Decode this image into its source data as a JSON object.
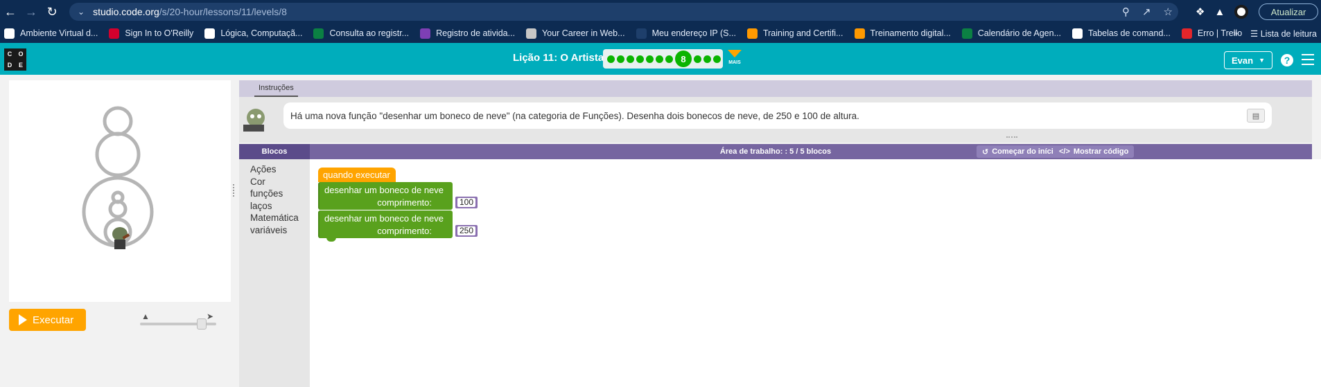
{
  "browser": {
    "url_host": "studio.code.org",
    "url_path": "/s/20-hour/lessons/11/levels/8",
    "update_label": "Atualizar"
  },
  "bookmarks": [
    {
      "label": "Ambiente Virtual d...",
      "icon": "globe-icon",
      "color": "#ffffff"
    },
    {
      "label": "Sign In to O'Reilly",
      "icon": "oreilly-icon",
      "color": "#d3002d"
    },
    {
      "label": "Lógica, Computaçã...",
      "icon": "notion-icon",
      "color": "#ffffff"
    },
    {
      "label": "Consulta ao registr...",
      "icon": "plus-icon",
      "color": "#0b8043"
    },
    {
      "label": "Registro de atividа...",
      "icon": "list-icon",
      "color": "#7e3fb5"
    },
    {
      "label": "Your Career in Web...",
      "icon": "career-icon",
      "color": "#c7c7c7"
    },
    {
      "label": "Meu endereço IP (S...",
      "icon": "ip-icon",
      "color": "#1e3f6b"
    },
    {
      "label": "Training and Certifi...",
      "icon": "aws-icon",
      "color": "#ff9900"
    },
    {
      "label": "Treinamento digital...",
      "icon": "aws-icon",
      "color": "#ff9900"
    },
    {
      "label": "Calendário de Agen...",
      "icon": "plus-icon",
      "color": "#0b8043"
    },
    {
      "label": "Tabelas de comand...",
      "icon": "wordpress-icon",
      "color": "#ffffff"
    },
    {
      "label": "Erro | Trello",
      "icon": "trello-icon",
      "color": "#e3262b"
    }
  ],
  "bookmarks_more": "»",
  "reading_list": "Lista de leitura",
  "header": {
    "logo_letters": [
      "C",
      "O",
      "D",
      "E"
    ],
    "lesson_title": "Lição 11: O Artista 3",
    "current_level": "8",
    "more_label": "MAIS",
    "user_label": "Evan",
    "progress": {
      "completed_before": 7,
      "after": 3
    }
  },
  "controls": {
    "run_label": "Executar",
    "speed_fraction": 0.85
  },
  "instructions": {
    "tab_label": "Instruções",
    "text": "Há uma nova função \"desenhar um boneco de neve\" (na categoria de Funções). Desenha dois bonecos de neve, de 250 e 100 de altura."
  },
  "workspace": {
    "blocks_tab": "Blocos",
    "title": "Área de trabalho: : 5 / 5 blocos",
    "restart_label": "Começar do início",
    "show_code_label": "Mostrar código",
    "toolbox": [
      "Ações",
      "Cor",
      "funções",
      "laços",
      "Matemática",
      "variáveis"
    ],
    "event_block": "quando executar",
    "function_blocks": [
      {
        "label": "desenhar um boneco de neve",
        "param": "comprimento:",
        "value": "100"
      },
      {
        "label": "desenhar um boneco de neve",
        "param": "comprimento:",
        "value": "250"
      }
    ]
  }
}
